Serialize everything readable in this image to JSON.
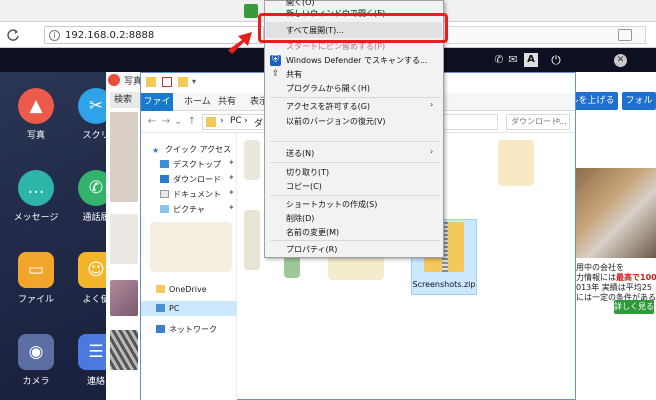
{
  "browser": {
    "url": "192.168.0.2:8888"
  },
  "phone_bar": {
    "a_label": "A"
  },
  "apps": [
    {
      "name": "app-photos",
      "label": "写真",
      "color": "#ec5a4a",
      "glyph": "▲"
    },
    {
      "name": "app-screenshot",
      "label": "スクリ",
      "color": "#2fa2e9",
      "glyph": "✂"
    },
    {
      "name": "app-message",
      "label": "メッセージ",
      "color": "#2db5a8",
      "glyph": "…"
    },
    {
      "name": "app-calls",
      "label": "通話履",
      "color": "#34b36a",
      "glyph": "✆"
    },
    {
      "name": "app-files",
      "label": "ファイル",
      "color": "#f1a52a",
      "glyph": "▭"
    },
    {
      "name": "app-yoku",
      "label": "よく使",
      "color": "#f3b52a",
      "glyph": "☺"
    },
    {
      "name": "app-camera",
      "label": "カメラ",
      "color": "#5c6fa3",
      "glyph": "◉"
    },
    {
      "name": "app-contacts",
      "label": "連絡",
      "color": "#4a7ae0",
      "glyph": "☰"
    }
  ],
  "photo_app": {
    "title": "写真",
    "search_label": "検索",
    "btn1": "ルを上げる",
    "btn2": "フォル"
  },
  "ad": {
    "line1a": "用中の会社を",
    "line1b": "",
    "line2a": "力情報には",
    "line2b": "最高で100万",
    "line3": "013年 実績は平均25",
    "line4": "には一定の条件がある",
    "btn": "詳しく見る"
  },
  "explorer": {
    "tabs": [
      "ファイル",
      "ホーム",
      "共有",
      "表示"
    ],
    "addr_pc": "PC",
    "addr_dl": "ダウ",
    "search_placeholder": "ダウンロード...",
    "nav": {
      "quick_access": "クイック アクセス",
      "desktop": "デスクトップ",
      "downloads": "ダウンロード",
      "documents": "ドキュメント",
      "pictures": "ピクチャ",
      "onedrive": "OneDrive",
      "pc": "PC",
      "network": "ネットワーク"
    },
    "selected_file": "Screenshots.zip"
  },
  "context_menu": {
    "top_cut": "開く(O)",
    "new_window": "新しいウィンドウで開く(E)",
    "extract_all": "すべて展開(T)...",
    "faded": "スタートにピン留めする(P)",
    "defender": "Windows Defender でスキャンする...",
    "share": "共有",
    "open_with": "プログラムから開く(H)",
    "grant_access": "アクセスを許可する(G)",
    "restore": "以前のバージョンの復元(V)",
    "send_to": "送る(N)",
    "cut": "切り取り(T)",
    "copy": "コピー(C)",
    "shortcut": "ショートカットの作成(S)",
    "delete": "削除(D)",
    "rename": "名前の変更(M)",
    "properties": "プロパティ(R)"
  },
  "colors": {
    "highlight_box": "#e61e1e",
    "explorer_accent": "#1979ca",
    "selection": "#cce8ff"
  }
}
